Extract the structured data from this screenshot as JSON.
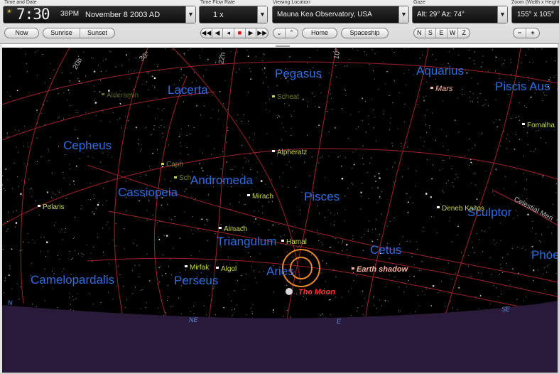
{
  "toolbar": {
    "time_date": {
      "label": "Time and Date",
      "time": "7:30",
      "ampm": "38PM",
      "date": "November  8  2003 AD",
      "buttons": [
        "Now",
        "Sunrise",
        "Sunset"
      ]
    },
    "flow_rate": {
      "label": "Time Flow Rate",
      "value": "1 x"
    },
    "viewing_location": {
      "label": "Viewing Location",
      "value": "Mauna Kea Observatory, USA",
      "buttons": [
        "Home",
        "Spaceship"
      ]
    },
    "gaze": {
      "label": "Gaze",
      "value": "Alt: 29° Az: 74°",
      "buttons": [
        "N",
        "S",
        "E",
        "W",
        "Z"
      ]
    },
    "zoom": {
      "label": "Zoom (Width x Height)",
      "value": "155° x 105°",
      "buttons": [
        "−",
        "+"
      ]
    }
  },
  "colors": {
    "constellation": "#2f6de0",
    "star": "#c8d84a",
    "grid": "#a0222c",
    "ground": "#2a1a3a",
    "moon": "#ff3030",
    "planet": "#ffb0a0",
    "orange_ring": "#e8882a"
  },
  "sky": {
    "constellations": [
      "Pegasus",
      "Aquarius",
      "Lacerta",
      "Piscis Aus",
      "Cepheus",
      "Andromeda",
      "Cassiopeia",
      "Pisces",
      "Sculptor",
      "Triangulum",
      "Cetus",
      "Phoe",
      "Aries",
      "Camelopardalis",
      "Perseus"
    ],
    "stars": [
      "Scheat",
      "Alpheratz",
      "Caph",
      "Sch",
      "Mirach",
      "Almach",
      "Hamal",
      "Mirfak",
      "Algol",
      "Polaris",
      "Deneb Kaitos",
      "Fomalha"
    ],
    "faint_stars": [
      "Alderamin"
    ],
    "bodies": [
      "Mars",
      "The Moon",
      "Earth shadow"
    ],
    "grid_labels": [
      "20h",
      "22h",
      "30°",
      "10°",
      "Celestial Meri"
    ],
    "horizon_labels": [
      "N",
      "NE",
      "E",
      "SE"
    ]
  }
}
